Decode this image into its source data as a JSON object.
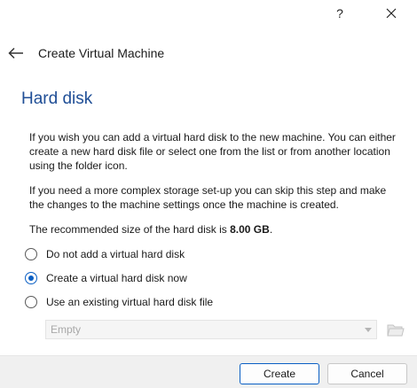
{
  "titlebar": {
    "help_label": "?",
    "close_icon": "close-icon"
  },
  "header": {
    "back_icon": "back-arrow-icon",
    "title": "Create Virtual Machine"
  },
  "page": {
    "title": "Hard disk",
    "para1": "If you wish you can add a virtual hard disk to the new machine. You can either create a new hard disk file or select one from the list or from another location using the folder icon.",
    "para2": "If you need a more complex storage set-up you can skip this step and make the changes to the machine settings once the machine is created.",
    "para3_prefix": "The recommended size of the hard disk is ",
    "para3_size": "8.00 GB",
    "para3_suffix": "."
  },
  "options": {
    "selected_index": 1,
    "items": [
      {
        "label": "Do not add a virtual hard disk"
      },
      {
        "label": "Create a virtual hard disk now"
      },
      {
        "label": "Use an existing virtual hard disk file"
      }
    ]
  },
  "disk_select": {
    "value": "Empty",
    "enabled": false,
    "folder_icon": "folder-icon"
  },
  "footer": {
    "create_label": "Create",
    "cancel_label": "Cancel"
  },
  "colors": {
    "accent": "#0a5fc4",
    "title": "#1f4e96"
  }
}
